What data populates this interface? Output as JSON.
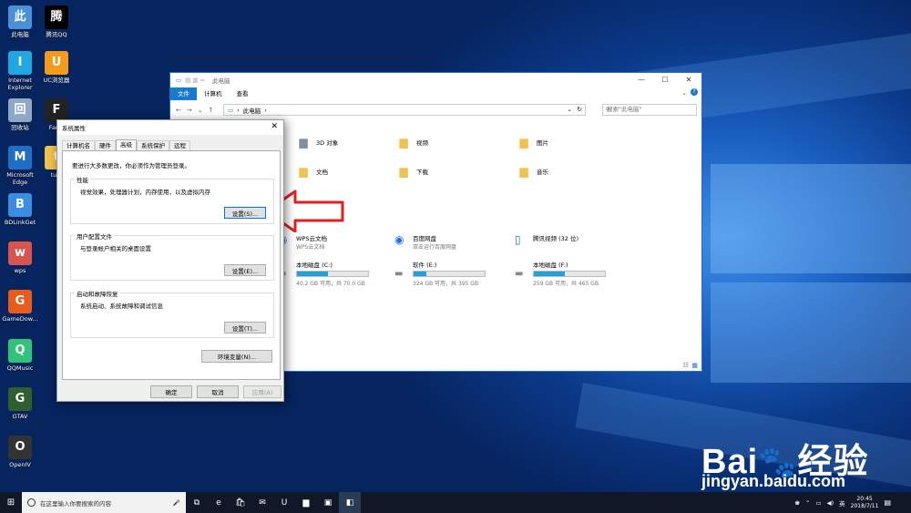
{
  "desktop_icons": [
    {
      "name": "this-pc",
      "label": "此电脑",
      "icon": "computer-icon",
      "color": "#4a90d9"
    },
    {
      "name": "tencent-qq",
      "label": "腾讯QQ",
      "icon": "penguin-icon",
      "color": "#000000"
    },
    {
      "name": "internet-explorer",
      "label": "Internet Explorer",
      "icon": "ie-icon",
      "color": "#1ea7e1"
    },
    {
      "name": "uc-browser",
      "label": "UC浏览器",
      "icon": "uc-icon",
      "color": "#f39a1a"
    },
    {
      "name": "recycle-bin",
      "label": "回收站",
      "icon": "recycle-bin-icon",
      "color": "#8fa9c4"
    },
    {
      "name": "far-cry",
      "label": "Far C",
      "icon": "game-icon",
      "color": "#222222"
    },
    {
      "name": "edge",
      "label": "Microsoft Edge",
      "icon": "edge-icon",
      "color": "#1f6fc5"
    },
    {
      "name": "tupian",
      "label": "tupi",
      "icon": "folder-icon",
      "color": "#f2c14e"
    },
    {
      "name": "bdlinkget",
      "label": "BDLinkGet",
      "icon": "link-icon",
      "color": "#3a8de0"
    },
    {
      "name": "wps",
      "label": "wps",
      "icon": "wps-icon",
      "color": "#d9534f"
    },
    {
      "name": "gamedownloader",
      "label": "GameDow...",
      "icon": "game-downloader-icon",
      "color": "#e65c1a"
    },
    {
      "name": "qqmusic",
      "label": "QQMusic",
      "icon": "music-icon",
      "color": "#31c27c"
    },
    {
      "name": "gtav",
      "label": "GTAV",
      "icon": "gtav-icon",
      "color": "#2f5f2f"
    },
    {
      "name": "openiv",
      "label": "OpenIV",
      "icon": "openiv-icon",
      "color": "#333333"
    }
  ],
  "explorer": {
    "title": "此电脑",
    "ribbon_tabs": [
      "文件",
      "计算机",
      "查看"
    ],
    "address": "此电脑",
    "search_placeholder": "搜索\"此电脑\"",
    "folders": [
      {
        "label": "3D 对象",
        "icon": "3d-objects-icon"
      },
      {
        "label": "视频",
        "icon": "video-folder-icon"
      },
      {
        "label": "图片",
        "icon": "pictures-folder-icon"
      },
      {
        "label": "文档",
        "icon": "documents-folder-icon"
      },
      {
        "label": "下载",
        "icon": "downloads-folder-icon"
      },
      {
        "label": "音乐",
        "icon": "music-folder-icon"
      }
    ],
    "apps": [
      {
        "label": "WPS云文档",
        "sub": "WPS云文档",
        "icon": "wps-cloud-icon"
      },
      {
        "label": "百度网盘",
        "sub": "双击运行百度网盘",
        "icon": "baidu-netdisk-icon"
      },
      {
        "label": "腾讯视频 (32 位)",
        "sub": "",
        "icon": "file-icon"
      }
    ],
    "drives": [
      {
        "label": "本地磁盘 (C:)",
        "free": "40.2 GB 可用，共 70.0 GB",
        "used": 0.43
      },
      {
        "label": "软件 (E:)",
        "free": "324 GB 可用，共 395 GB",
        "used": 0.18
      },
      {
        "label": "本地磁盘 (F:)",
        "free": "259 GB 可用，共 465 GB",
        "used": 0.44
      }
    ]
  },
  "dialog": {
    "title": "系统属性",
    "tabs": [
      "计算机名",
      "硬件",
      "高级",
      "系统保护",
      "远程"
    ],
    "active_tab": "高级",
    "note": "要进行大多数更改，你必须作为管理员登录。",
    "groups": [
      {
        "title": "性能",
        "desc": "视觉效果，处理器计划，内存使用，以及虚拟内存",
        "button": "设置(S)..."
      },
      {
        "title": "用户配置文件",
        "desc": "与登录帐户相关的桌面设置",
        "button": "设置(E)..."
      },
      {
        "title": "启动和故障恢复",
        "desc": "系统启动、系统故障和调试信息",
        "button": "设置(T)..."
      }
    ],
    "env_button": "环境变量(N)...",
    "ok": "确定",
    "cancel": "取消",
    "apply": "应用(A)"
  },
  "annotation": {
    "arrow_color": "#e02020"
  },
  "taskbar": {
    "search_placeholder": "在这里输入你要搜索的内容",
    "apps": [
      "task-view-icon",
      "edge-icon",
      "store-icon",
      "mail-icon",
      "uc-icon",
      "folder-icon",
      "explorer-icon",
      "system-icon"
    ],
    "ime": "英",
    "time": "20:45",
    "date": "2018/7/11"
  },
  "watermark": {
    "brand_left": "Bai",
    "brand_right": "经验",
    "url": "jingyan.baidu.com"
  }
}
